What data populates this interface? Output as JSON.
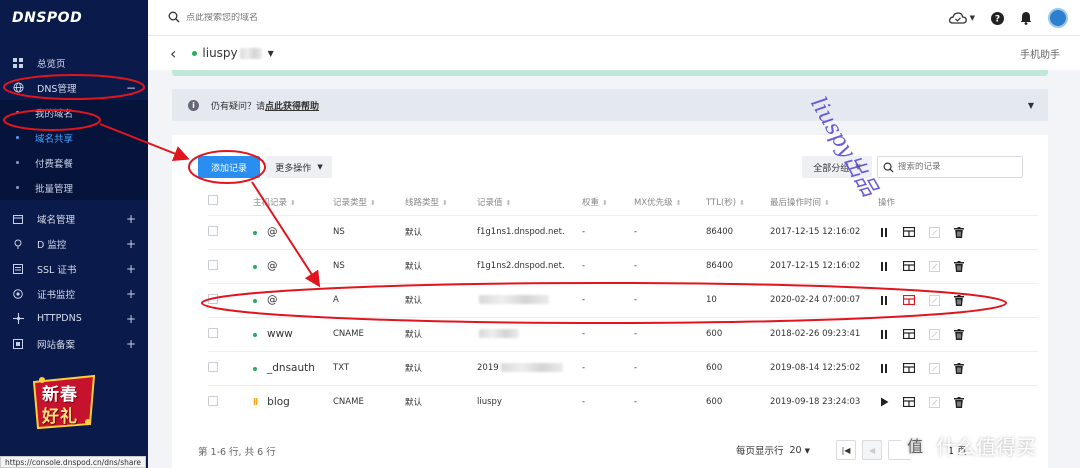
{
  "sidebar": {
    "logo": "DNSPOD",
    "items": [
      {
        "label": "总览页",
        "icon": "dashboard-icon"
      },
      {
        "label": "DNS管理",
        "icon": "globe-icon",
        "toggle": "−"
      }
    ],
    "dns_sub": [
      {
        "label": "我的域名",
        "active": false
      },
      {
        "label": "域名共享",
        "active": true
      },
      {
        "label": "付费套餐",
        "active": false
      },
      {
        "label": "批量管理",
        "active": false
      }
    ],
    "more": [
      {
        "label": "域名管理",
        "icon": "calendar-icon",
        "toggle": "+"
      },
      {
        "label": "D 监控",
        "icon": "location-icon",
        "toggle": "+"
      },
      {
        "label": "SSL 证书",
        "icon": "certificate-icon",
        "toggle": "+"
      },
      {
        "label": "证书监控",
        "icon": "target-icon",
        "toggle": "+"
      },
      {
        "label": "HTTPDNS",
        "icon": "network-icon",
        "toggle": "+"
      },
      {
        "label": "网站备案",
        "icon": "record-icon",
        "toggle": "+"
      }
    ],
    "promo": {
      "line1": "新春",
      "line2": "好礼"
    },
    "status_url": "https://console.dnspod.cn/dns/share"
  },
  "topbar": {
    "search_placeholder": "点此搜索您的域名"
  },
  "domain_header": {
    "name": "liuspy",
    "helper": "手机助手"
  },
  "helpbar": {
    "text": "仍有疑问？请",
    "link": "点此获得帮助"
  },
  "toolbar": {
    "add_record": "添加记录",
    "more_ops": "更多操作",
    "all_groups": "全部分组",
    "search_placeholder": "搜索的记录"
  },
  "table": {
    "headers": [
      "主机记录",
      "记录类型",
      "线路类型",
      "记录值",
      "权重",
      "MX优先级",
      "TTL(秒)",
      "最后操作时间",
      "操作"
    ],
    "rows": [
      {
        "status": "enabled",
        "host": "@",
        "type": "NS",
        "line": "默认",
        "value": "f1g1ns1.dnspod.net.",
        "weight": "-",
        "mx": "-",
        "ttl": "86400",
        "time": "2017-12-15 12:16:02",
        "toggle_icon": "pause-icon"
      },
      {
        "status": "enabled",
        "host": "@",
        "type": "NS",
        "line": "默认",
        "value": "f1g1ns2.dnspod.net.",
        "weight": "-",
        "mx": "-",
        "ttl": "86400",
        "time": "2017-12-15 12:16:02",
        "toggle_icon": "pause-icon"
      },
      {
        "status": "enabled",
        "host": "@",
        "type": "A",
        "line": "默认",
        "value": "",
        "weight": "-",
        "mx": "-",
        "ttl": "10",
        "time": "2020-02-24 07:00:07",
        "toggle_icon": "pause-icon"
      },
      {
        "status": "enabled",
        "host": "www",
        "type": "CNAME",
        "line": "默认",
        "value": "",
        "weight": "-",
        "mx": "-",
        "ttl": "600",
        "time": "2018-02-26 09:23:41",
        "toggle_icon": "pause-icon"
      },
      {
        "status": "enabled",
        "host": "_dnsauth",
        "type": "TXT",
        "line": "默认",
        "value": "2019",
        "weight": "-",
        "mx": "-",
        "ttl": "600",
        "time": "2019-08-14 12:25:02",
        "toggle_icon": "pause-icon"
      },
      {
        "status": "paused",
        "host": "blog",
        "type": "CNAME",
        "line": "默认",
        "value": "liuspy",
        "weight": "-",
        "mx": "-",
        "ttl": "600",
        "time": "2019-09-18 23:24:03",
        "toggle_icon": "play-icon"
      }
    ]
  },
  "footer": {
    "summary": "第 1-6 行, 共 6 行",
    "per_page_label": "每页显示行",
    "per_page_value": "20",
    "page_text": "1 页"
  },
  "watermark": {
    "text": "liuspy出品",
    "brand": "什么值得买",
    "badge": "值"
  },
  "colors": {
    "sidebar_bg": "#0a1a4a",
    "accent": "#2a8ef0",
    "success": "#27ae60",
    "paused": "#f5a623",
    "annotation": "#e0161e"
  }
}
